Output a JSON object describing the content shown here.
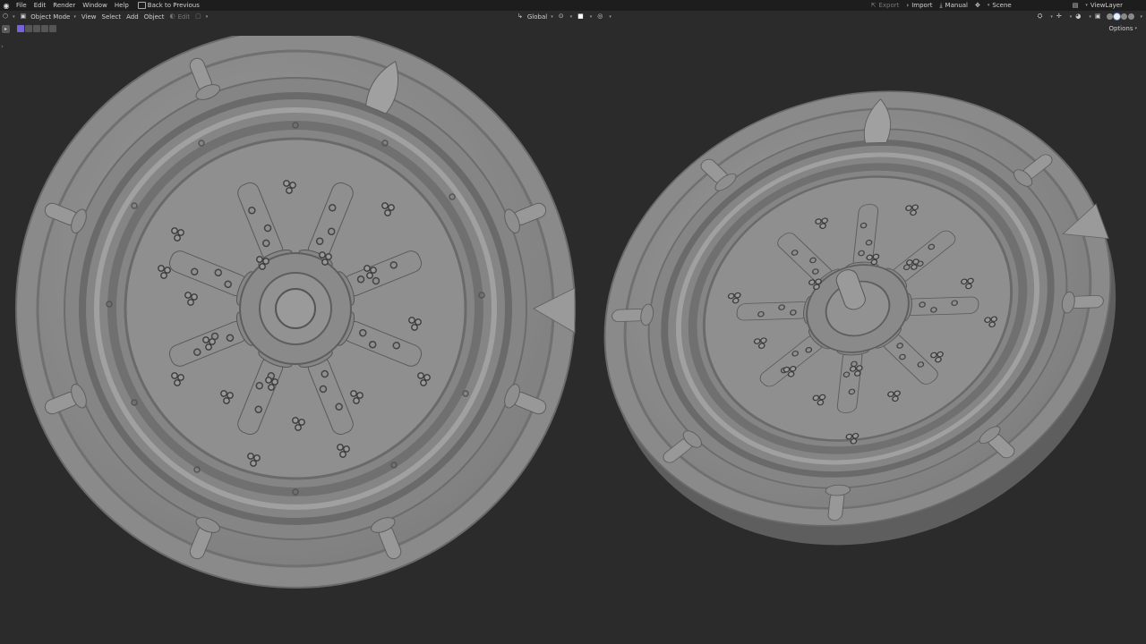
{
  "menu": {
    "items": [
      "File",
      "Edit",
      "Render",
      "Window",
      "Help"
    ],
    "back_label": "Back to Previous",
    "export_label": "Export",
    "import_label": "Import",
    "manual_label": "Manual",
    "scene_label": "Scene",
    "viewlayer_label": "ViewLayer"
  },
  "header": {
    "mode_label": "Object Mode",
    "menus": [
      "View",
      "Select",
      "Add",
      "Object"
    ],
    "edit_label": "Edit",
    "orientation_label": "Global",
    "options_label": "Options"
  },
  "colors": {
    "background": "#2b2b2b",
    "topbar": "#1d1d1d",
    "mesh": "#8c8c8c",
    "accent": "#7a62d8"
  }
}
